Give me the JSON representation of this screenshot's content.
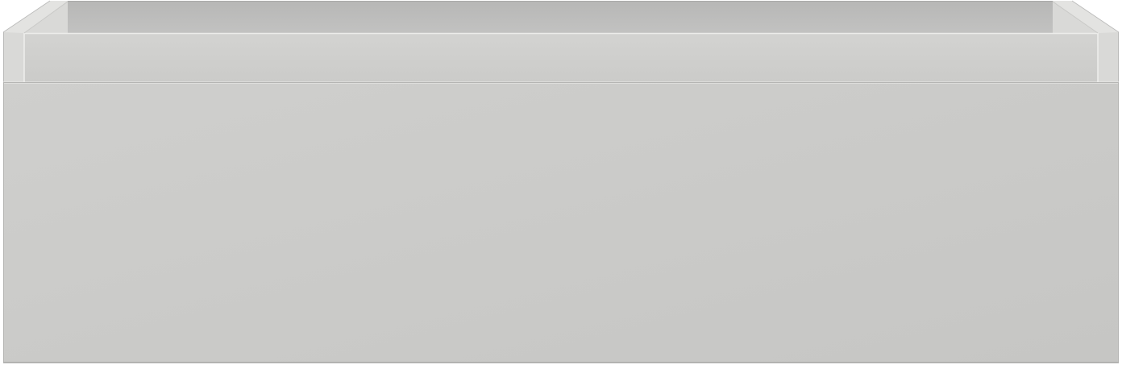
{
  "object": {
    "kind": "drawer-box-render",
    "colors": {
      "front_panel": "#cbcbc9",
      "inner_back_wall": "#bdbdbc",
      "side_wall": "#d7d7d5",
      "top_edge": "#e6e6e4",
      "inner_lip": "#d0d0ce",
      "outline": "#9a9a98"
    }
  }
}
